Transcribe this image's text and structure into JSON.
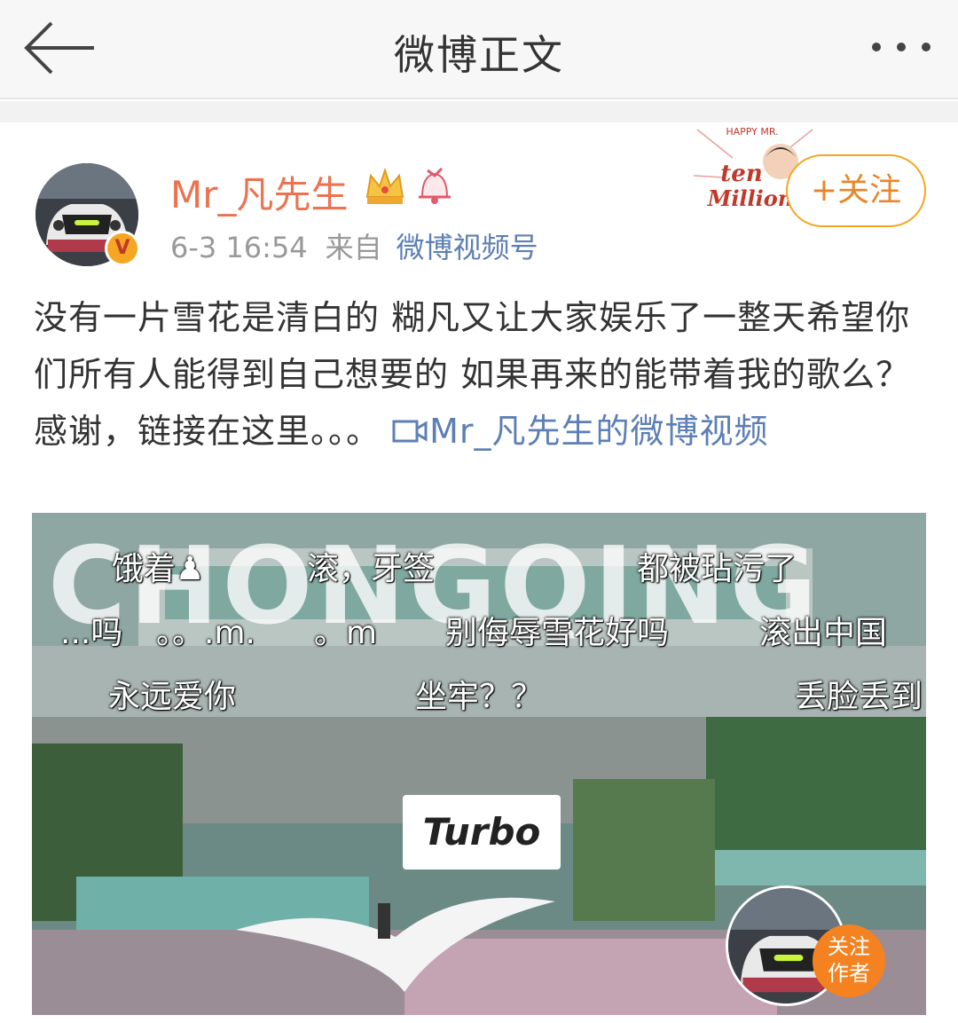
{
  "header": {
    "title": "微博正文"
  },
  "post": {
    "author": "Mr_凡先生",
    "verified_badge": "V",
    "time": "6-3 16:54",
    "from_label": "来自",
    "source": "微博视频号",
    "follow_label": "+关注",
    "sticker_text": "ten Million",
    "sticker_top": "HAPPY MR.",
    "text_main": "没有一片雪花是清白的 糊凡又让大家娱乐了一整天希望你们所有人能得到自己想要的 如果再来的能带着我的歌么？ 感谢，链接在这里。。。 ",
    "text_link": "Mr_凡先生的微博视频"
  },
  "video": {
    "watermark": "CHONGQING",
    "danmaku": [
      "饿着♟",
      "滚，牙签",
      "都被玷污了",
      "...吗",
      "。。.m.",
      "。m",
      "别侮辱雪花好吗",
      "滚出中国",
      "永远爱你",
      "坐牢？？",
      "丢脸丢到"
    ],
    "caption": "Turbo",
    "follow_author": "关注作者",
    "follow_line1": "关注",
    "follow_line2": "作者"
  },
  "colors": {
    "accent": "#eb7350",
    "link": "#5d7fb5",
    "follow_border": "#f5a623"
  }
}
